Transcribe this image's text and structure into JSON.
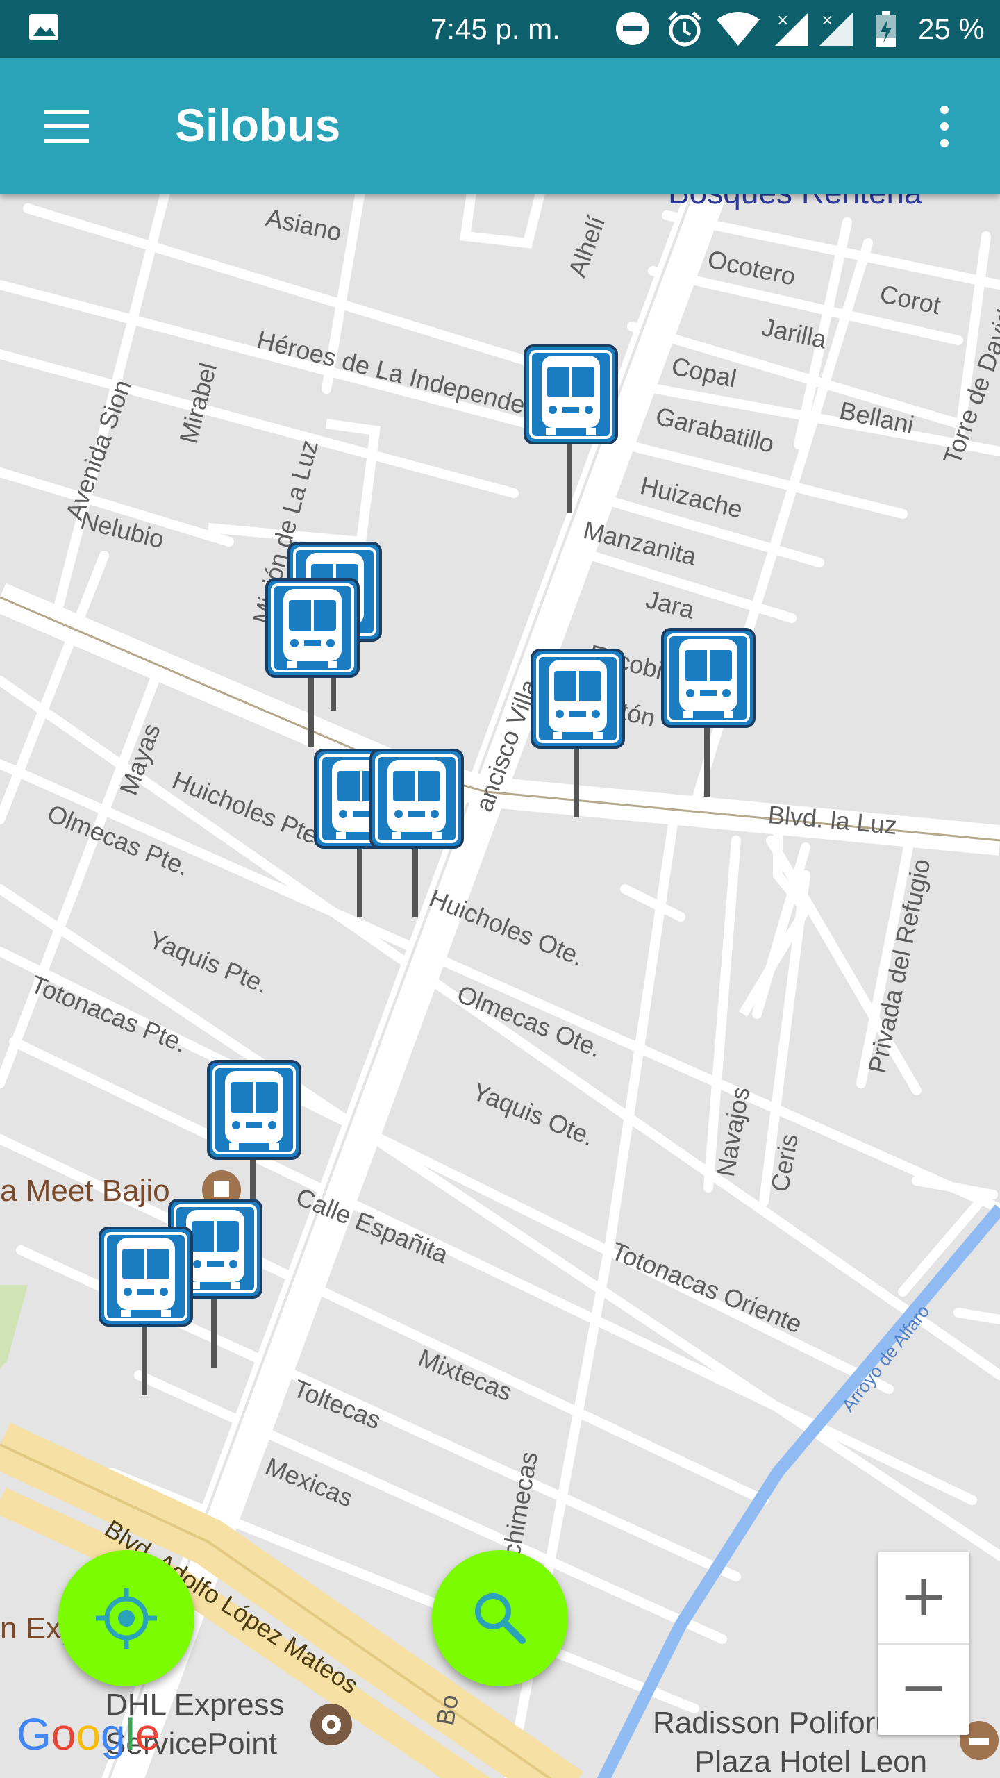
{
  "status_bar": {
    "time": "7:45 p. m.",
    "battery": "25 %",
    "icons": [
      "image-icon",
      "dnd-icon",
      "alarm-icon",
      "wifi-icon",
      "signal-icon",
      "signal-icon-2",
      "battery-icon"
    ]
  },
  "app_bar": {
    "title": "Silobus",
    "menu_icon": "hamburger-menu-icon",
    "overflow_icon": "more-vertical-icon",
    "color": "#2aa3b8"
  },
  "map": {
    "street_labels": {
      "bosques": "Bosques Renteria",
      "asiano": "Asiano",
      "alheli": "Alhelí",
      "ocotero": "Ocotero",
      "corot": "Corot",
      "jarilla": "Jarilla",
      "copal": "Copal",
      "bellani": "Bellani",
      "torre": "Torre de David",
      "heroes": "Héroes de La Independe",
      "garabatillo": "Garabatillo",
      "huizache": "Huizache",
      "manzanita": "Manzanita",
      "jara": "Jara",
      "escobilla": "Escobi",
      "arton": "rtón",
      "avenida_sion": "Avenida Sion",
      "mirabel": "Mirabel",
      "nelubio": "Nelubio",
      "mision": "Misión de La Luz",
      "francisco": "ancisco Villa",
      "blvd_luz": "Blvd. la Luz",
      "mayas": "Mayas",
      "huicholes_pte": "Huicholes Pte",
      "olmecas_pte": "Olmecas Pte.",
      "huicholes_ote": "Huicholes Ote.",
      "privada": "Privada del Refugio",
      "yaquis_pte": "Yaquis Pte.",
      "olmecas_ote": "Olmecas Ote.",
      "totonacas_pte": "Totonacas Pte.",
      "yaquis_ote": "Yaquis Ote.",
      "navajos": "Navajos",
      "ceris": "Ceris",
      "calle_espanita": "Calle Españita",
      "totonacas_oriente": "Totonacas Oriente",
      "arroyo": "Arroyo de Alfaro",
      "mixtecas": "Mixtecas",
      "toltecas": "Toltecas",
      "mexicas": "Mexicas",
      "blvd_adolfo": "Blvd. Adolfo López Mateos",
      "chichimecas": "Chichimecas",
      "bo": "Bo"
    },
    "pois": {
      "meet_bajio": "a Meet Bajio",
      "exp": "n Exp",
      "dhl_1": "DHL Express",
      "dhl_2": "ServicePoint",
      "radisson_1": "Radisson Poliforum",
      "radisson_2": "Plaza Hotel Leon"
    },
    "bus_stop_icon": "bus-stop-icon",
    "bus_stop_color": "#1a7dc1"
  },
  "controls": {
    "zoom_in": "+",
    "zoom_out": "−",
    "locate_icon": "my-location-icon",
    "search_icon": "search-icon",
    "fab_color": "#7cfc00"
  },
  "attribution": {
    "letters": [
      "G",
      "o",
      "o",
      "g",
      "l",
      "e"
    ]
  }
}
